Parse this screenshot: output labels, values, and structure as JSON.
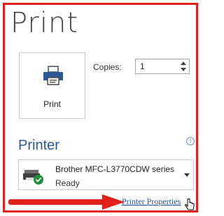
{
  "title": "Print",
  "print_button": {
    "label": "Print",
    "icon": "printer-icon"
  },
  "copies": {
    "label": "Copies:",
    "value": "1"
  },
  "printer_section": {
    "title": "Printer",
    "info_icon": "info-icon",
    "selected_printer": {
      "name": "Brother MFC-L3770CDW series",
      "status": "Ready",
      "icon": "printer-ready-icon"
    },
    "properties_link": "Printer Properties"
  },
  "colors": {
    "frame": "#e2211c",
    "accent": "#2b5797",
    "arrow": "#e2211c",
    "link": "#1f4e9c"
  }
}
